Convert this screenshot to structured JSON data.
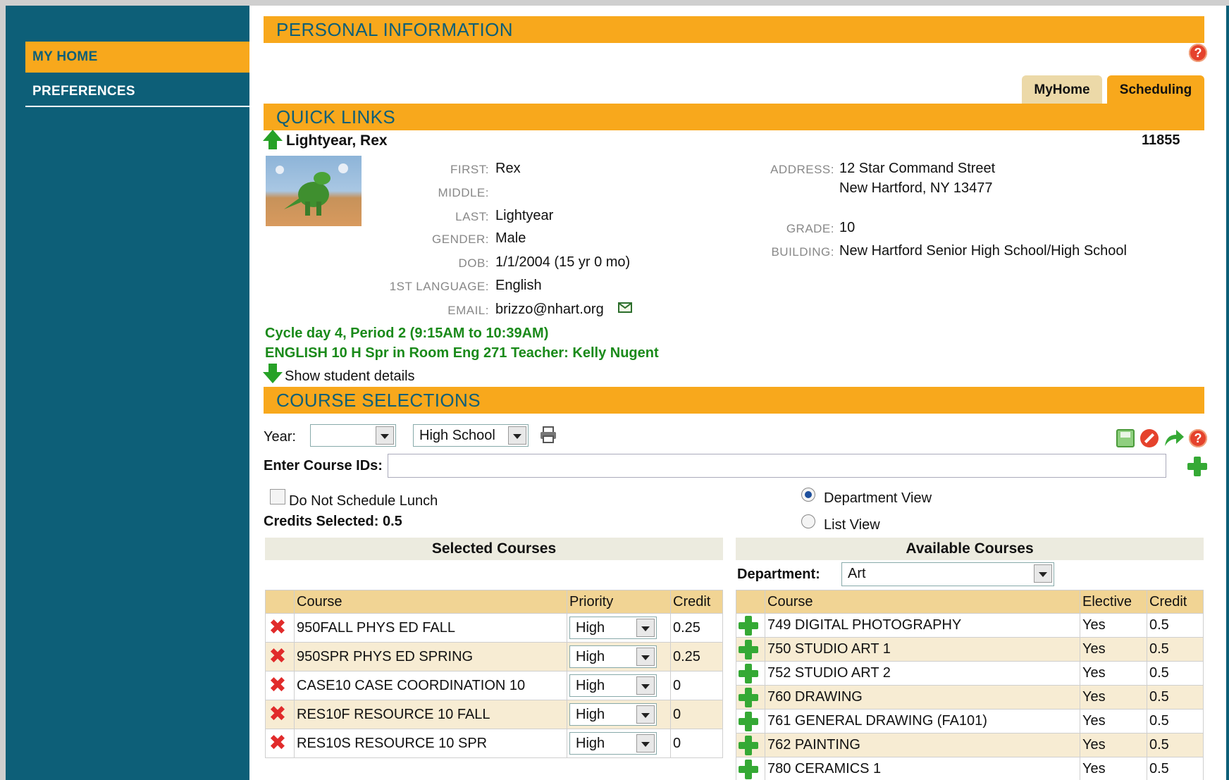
{
  "sidebar": {
    "items": [
      {
        "label": "MY HOME"
      },
      {
        "label": "PREFERENCES"
      }
    ]
  },
  "header": {
    "title": "PERSONAL INFORMATION",
    "help": "?"
  },
  "tabs": [
    {
      "label": "MyHome"
    },
    {
      "label": "Scheduling"
    }
  ],
  "quick_links": {
    "title": "QUICK LINKS"
  },
  "student": {
    "name": "Lightyear, Rex",
    "id": "11855",
    "fields": {
      "first_label": "FIRST:",
      "first": "Rex",
      "middle_label": "MIDDLE:",
      "middle": "",
      "last_label": "LAST:",
      "last": "Lightyear",
      "gender_label": "GENDER:",
      "gender": "Male",
      "dob_label": "DOB:",
      "dob": "1/1/2004 (15 yr 0 mo)",
      "lang_label": "1ST LANGUAGE:",
      "lang": "English",
      "email_label": "EMAIL:",
      "email": "brizzo@nhart.org",
      "address_label": "ADDRESS:",
      "address1": "12 Star Command Street",
      "address2": "New Hartford, NY 13477",
      "grade_label": "GRADE:",
      "grade": "10",
      "building_label": "BUILDING:",
      "building": "New Hartford Senior High School/High School"
    },
    "schedule_line1": "Cycle day 4, Period 2 (9:15AM to 10:39AM)",
    "schedule_line2": "ENGLISH 10 H Spr in Room Eng 271 Teacher: Kelly Nugent",
    "show_details": "Show student details"
  },
  "course_selections": {
    "title": "COURSE SELECTIONS",
    "year_label": "Year:",
    "year_value": "",
    "level_value": "High School",
    "enter_ids_label": "Enter Course IDs:",
    "enter_ids_value": "",
    "no_lunch_label": "Do Not Schedule Lunch",
    "credits_label": "Credits Selected: 0.5",
    "view_department": "Department View",
    "view_list": "List View",
    "selected_view": "Department View",
    "selected": {
      "title": "Selected Courses",
      "headers": [
        "Course",
        "Priority",
        "Credit"
      ],
      "rows": [
        {
          "course": "950FALL PHYS ED FALL",
          "priority": "High",
          "credit": "0.25"
        },
        {
          "course": "950SPR PHYS ED SPRING",
          "priority": "High",
          "credit": "0.25"
        },
        {
          "course": "CASE10 CASE COORDINATION 10",
          "priority": "High",
          "credit": "0"
        },
        {
          "course": "RES10F RESOURCE 10 FALL",
          "priority": "High",
          "credit": "0"
        },
        {
          "course": "RES10S RESOURCE 10 SPR",
          "priority": "High",
          "credit": "0"
        }
      ]
    },
    "available": {
      "title": "Available Courses",
      "department_label": "Department:",
      "department_value": "Art",
      "headers": [
        "Course",
        "Elective",
        "Credit"
      ],
      "rows": [
        {
          "course": "749 DIGITAL PHOTOGRAPHY",
          "elective": "Yes",
          "credit": "0.5"
        },
        {
          "course": "750 STUDIO ART 1",
          "elective": "Yes",
          "credit": "0.5"
        },
        {
          "course": "752 STUDIO ART 2",
          "elective": "Yes",
          "credit": "0.5"
        },
        {
          "course": "760 DRAWING",
          "elective": "Yes",
          "credit": "0.5"
        },
        {
          "course": "761 GENERAL DRAWING (FA101)",
          "elective": "Yes",
          "credit": "0.5"
        },
        {
          "course": "762 PAINTING",
          "elective": "Yes",
          "credit": "0.5"
        },
        {
          "course": "780 CERAMICS 1",
          "elective": "Yes",
          "credit": "0.5"
        }
      ]
    }
  },
  "colors": {
    "teal": "#0d5f78",
    "orange": "#f8a81c",
    "green": "#1a8a1a",
    "row_alt": "#f7ecd3"
  }
}
